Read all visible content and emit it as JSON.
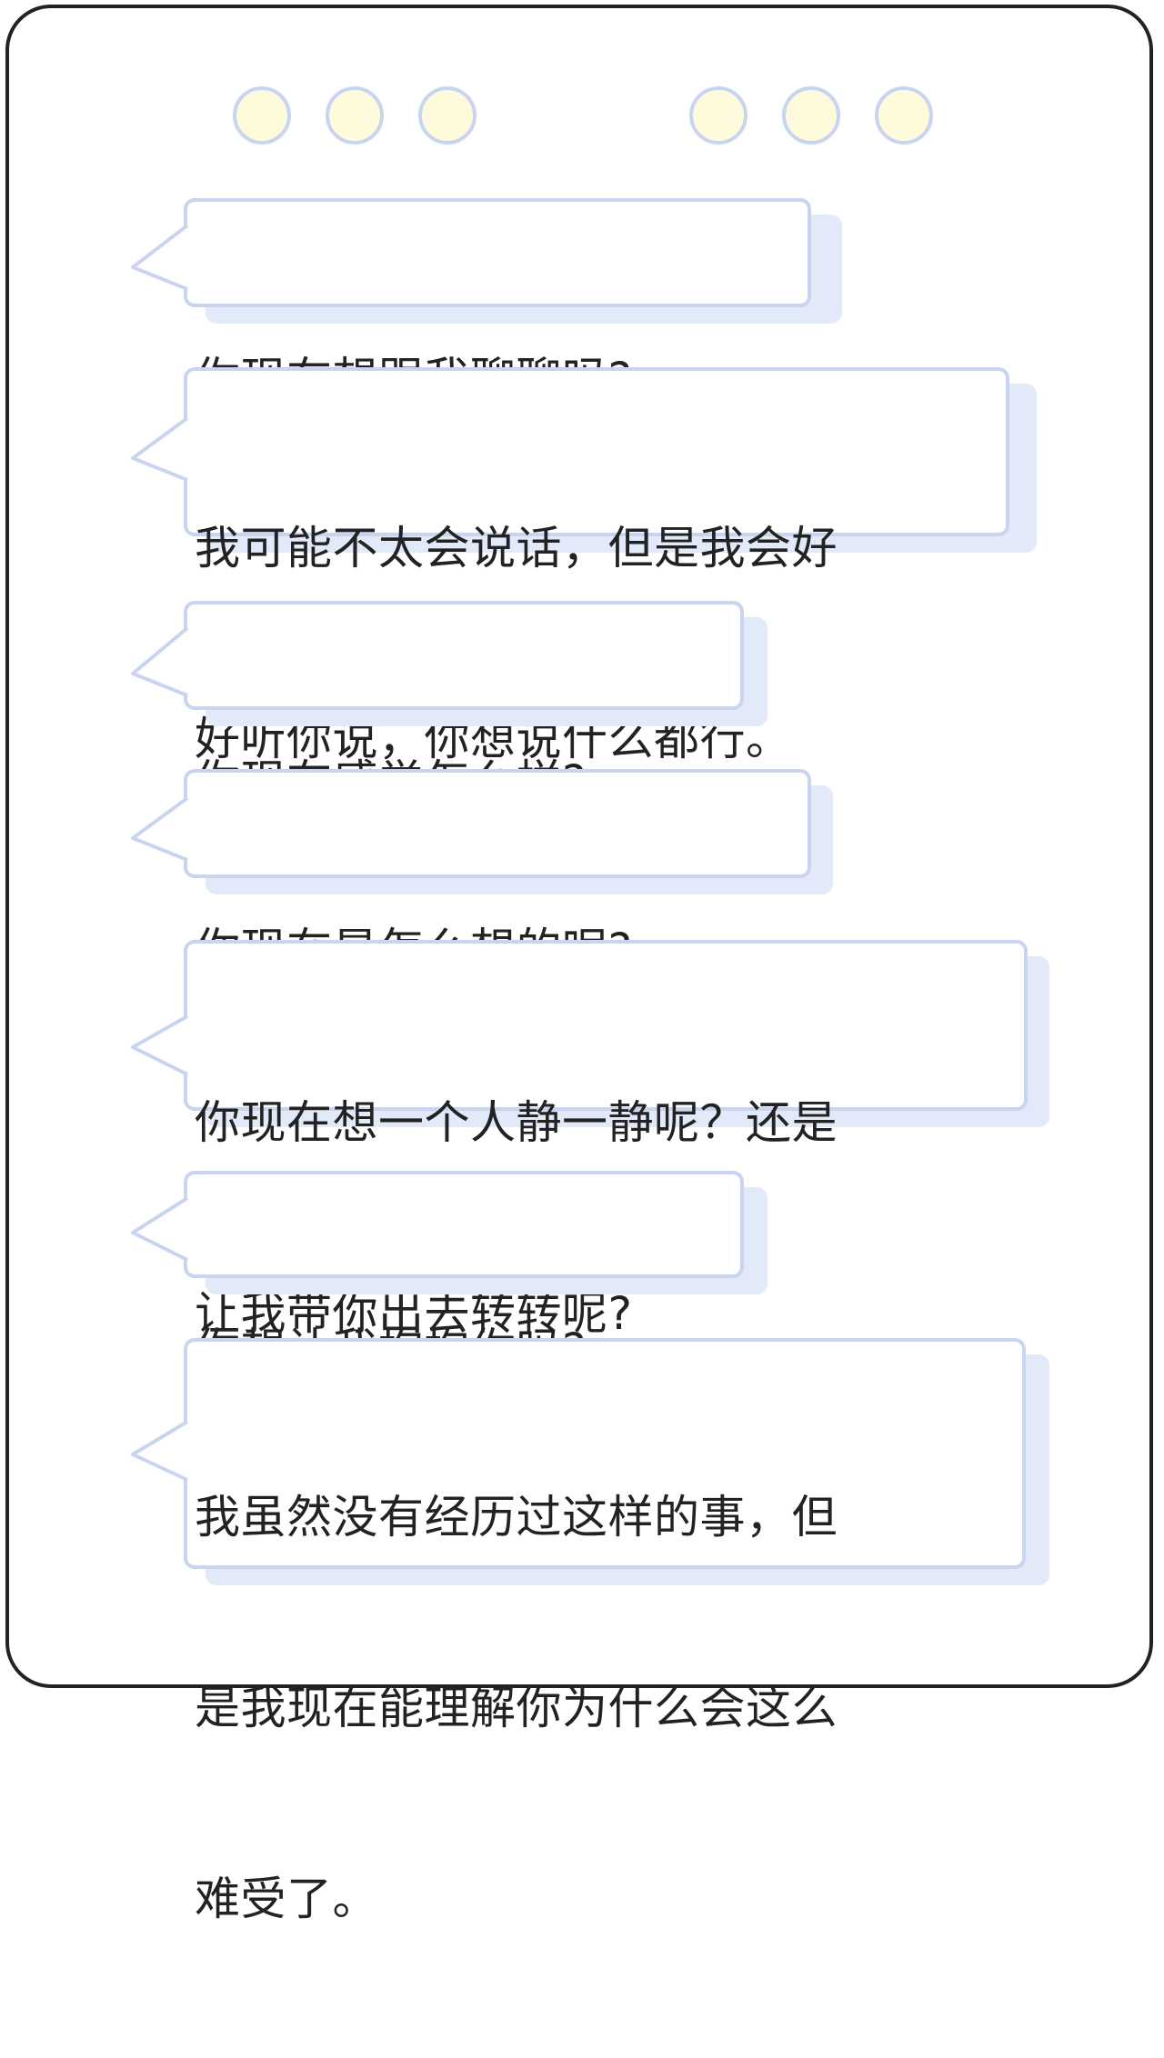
{
  "colors": {
    "frame": "#222222",
    "bubble_border": "#c9d5f0",
    "bubble_shadow": "#e2e9f8",
    "dot_fill": "#fdfbdc",
    "text": "#222222"
  },
  "messages": [
    {
      "lines": [
        "你现在想跟我聊聊吗?"
      ]
    },
    {
      "lines": [
        "我可能不太会说话，但是我会好",
        "好听你说，你想说什么都行。"
      ]
    },
    {
      "lines": [
        "你现在感觉怎么样?"
      ]
    },
    {
      "lines": [
        "你现在是怎么想的呢?"
      ]
    },
    {
      "lines": [
        "你现在想一个人静一静呢？还是",
        "让我带你出去转转呢?"
      ]
    },
    {
      "lines": [
        "你想让我抱抱你吗?"
      ]
    },
    {
      "lines": [
        "我虽然没有经历过这样的事，但",
        "是我现在能理解你为什么会这么",
        "难受了。"
      ]
    }
  ]
}
